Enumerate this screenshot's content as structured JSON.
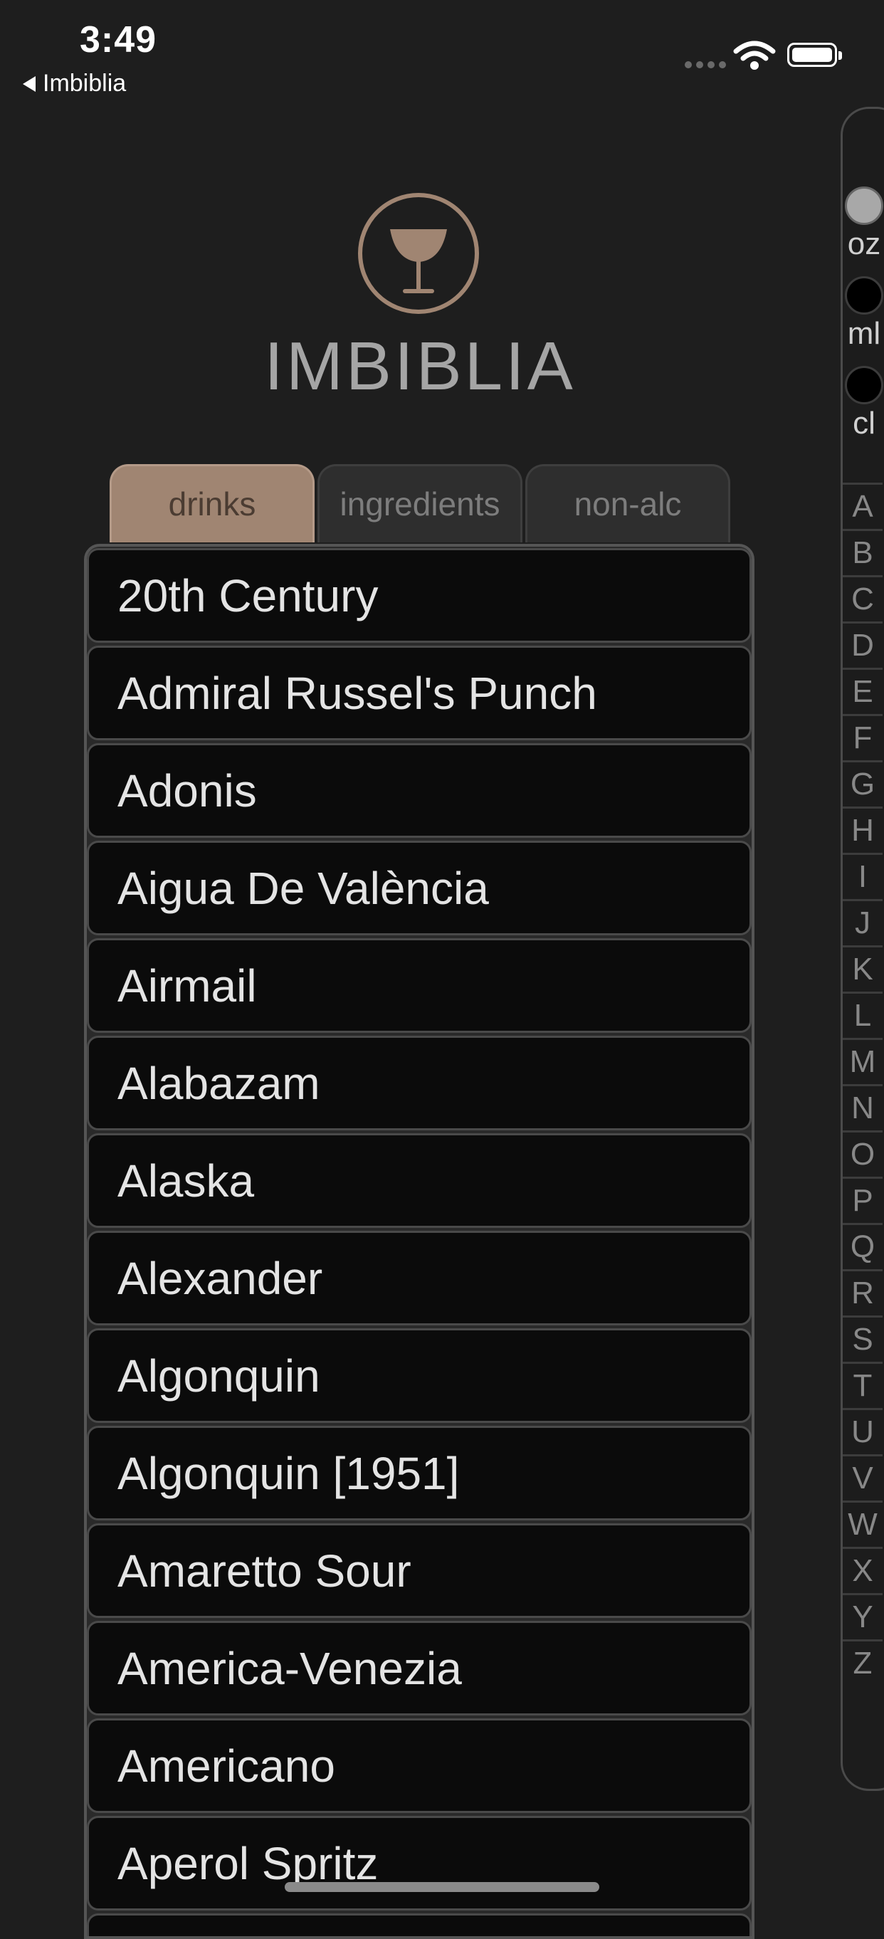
{
  "status": {
    "time": "3:49",
    "back_label": "Imbiblia"
  },
  "brand": {
    "title": "IMBIBLIA",
    "logo_icon": "cocktail-glass-icon",
    "accent": "#a08572"
  },
  "tabs": [
    {
      "label": "drinks",
      "active": true
    },
    {
      "label": "ingredients",
      "active": false
    },
    {
      "label": "non-alc",
      "active": false
    }
  ],
  "drinks": [
    "20th Century",
    "Admiral Russel's Punch",
    "Adonis",
    "Aigua De València",
    "Airmail",
    "Alabazam",
    "Alaska",
    "Alexander",
    "Algonquin",
    "Algonquin [1951]",
    "Amaretto Sour",
    "America-Venezia",
    "Americano",
    "Aperol Spritz"
  ],
  "units": [
    {
      "label": "oz",
      "selected": true
    },
    {
      "label": "ml",
      "selected": false
    },
    {
      "label": "cl",
      "selected": false
    }
  ],
  "index_letters": [
    "A",
    "B",
    "C",
    "D",
    "E",
    "F",
    "G",
    "H",
    "I",
    "J",
    "K",
    "L",
    "M",
    "N",
    "O",
    "P",
    "Q",
    "R",
    "S",
    "T",
    "U",
    "V",
    "W",
    "X",
    "Y",
    "Z"
  ]
}
